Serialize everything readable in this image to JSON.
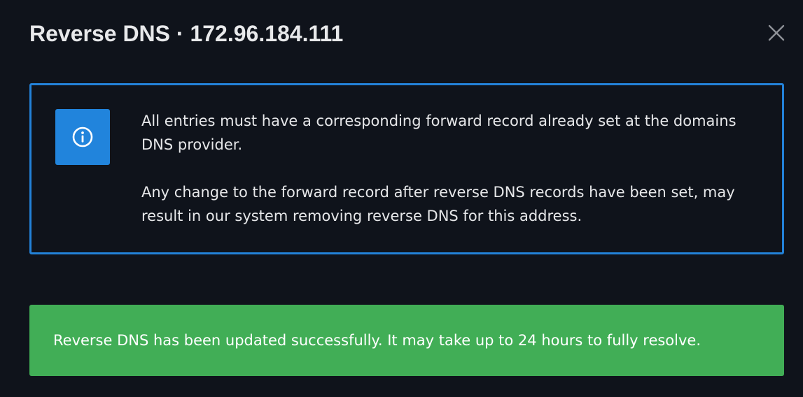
{
  "modal": {
    "title": "Reverse DNS · 172.96.184.111",
    "close_icon": "close-icon"
  },
  "info": {
    "icon": "info-circle-icon",
    "accent_color": "#2382d9",
    "paragraph1": "All entries must have a corresponding forward record already set at the domains DNS provider.",
    "paragraph2": "Any change to the forward record after reverse DNS records have been set, may result in our system removing reverse DNS for this address."
  },
  "alert": {
    "type": "success",
    "color": "#41ae56",
    "message": "Reverse DNS has been updated successfully. It may take up to 24 hours to fully resolve."
  }
}
